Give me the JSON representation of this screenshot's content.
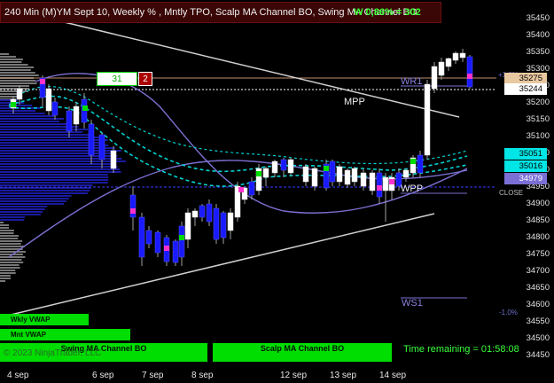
{
  "chart_title": "240 Min (M)YM Sept 10, Weekly % , Mntly TPO, Scalp MA Channel BO, Swing MA Channel BO",
  "return_label": "W 0,86% = 302",
  "box_left_value": "31",
  "box_right_value": "2",
  "pivot_labels": {
    "wr1": "WR1",
    "mpp": "MPP",
    "wpp": "WPP",
    "ws1": "WS1"
  },
  "pct_labels": {
    "up": "+1.0%",
    "down": "-1.0%"
  },
  "vwap_labels": {
    "weekly": "Wkly VWAP",
    "monthly": "Mnt VWAP"
  },
  "strip_labels": {
    "swing": "Swing MA Channel BO",
    "scalp": "Scalp MA Channel BO"
  },
  "copyright": "© 2023 NinjaTrader, LLC",
  "time_remaining": "Time remaining = 01:58:08",
  "close_label": "CLOSE",
  "price_axis": {
    "ticks": [
      "35450",
      "35400",
      "35350",
      "35300",
      "35250",
      "35200",
      "35150",
      "35100",
      "35050",
      "35000",
      "34950",
      "34900",
      "34850",
      "34800",
      "34750",
      "34700",
      "34650",
      "34600",
      "34550",
      "34500",
      "34450"
    ],
    "tags": [
      {
        "value": "35275",
        "bg": "#e8c8a0",
        "fg": "#000000"
      },
      {
        "value": "35244",
        "bg": "#ffffff",
        "fg": "#000000"
      },
      {
        "value": "35051",
        "bg": "#00e5e5",
        "fg": "#000000"
      },
      {
        "value": "35016",
        "bg": "#00e5e5",
        "fg": "#000000"
      },
      {
        "value": "34979",
        "bg": "#7b6fd6",
        "fg": "#ffffff"
      }
    ]
  },
  "date_labels": [
    "4 sep",
    "6 sep",
    "7 sep",
    "8 sep",
    "12 sep",
    "13 sep",
    "14 sep"
  ],
  "colors": {
    "bull_candle": "#ffffff",
    "bear_candle": "#1a1aff",
    "breakout_long": "#00dd00",
    "breakout_short": "#ff33cc",
    "ma_channel": "#00d0d0",
    "pivot_line": "#7a6fd0",
    "trend_line": "#d0d0d0",
    "tpo_profile": "#1a1aa0",
    "weekly_profile": "#777777"
  }
}
